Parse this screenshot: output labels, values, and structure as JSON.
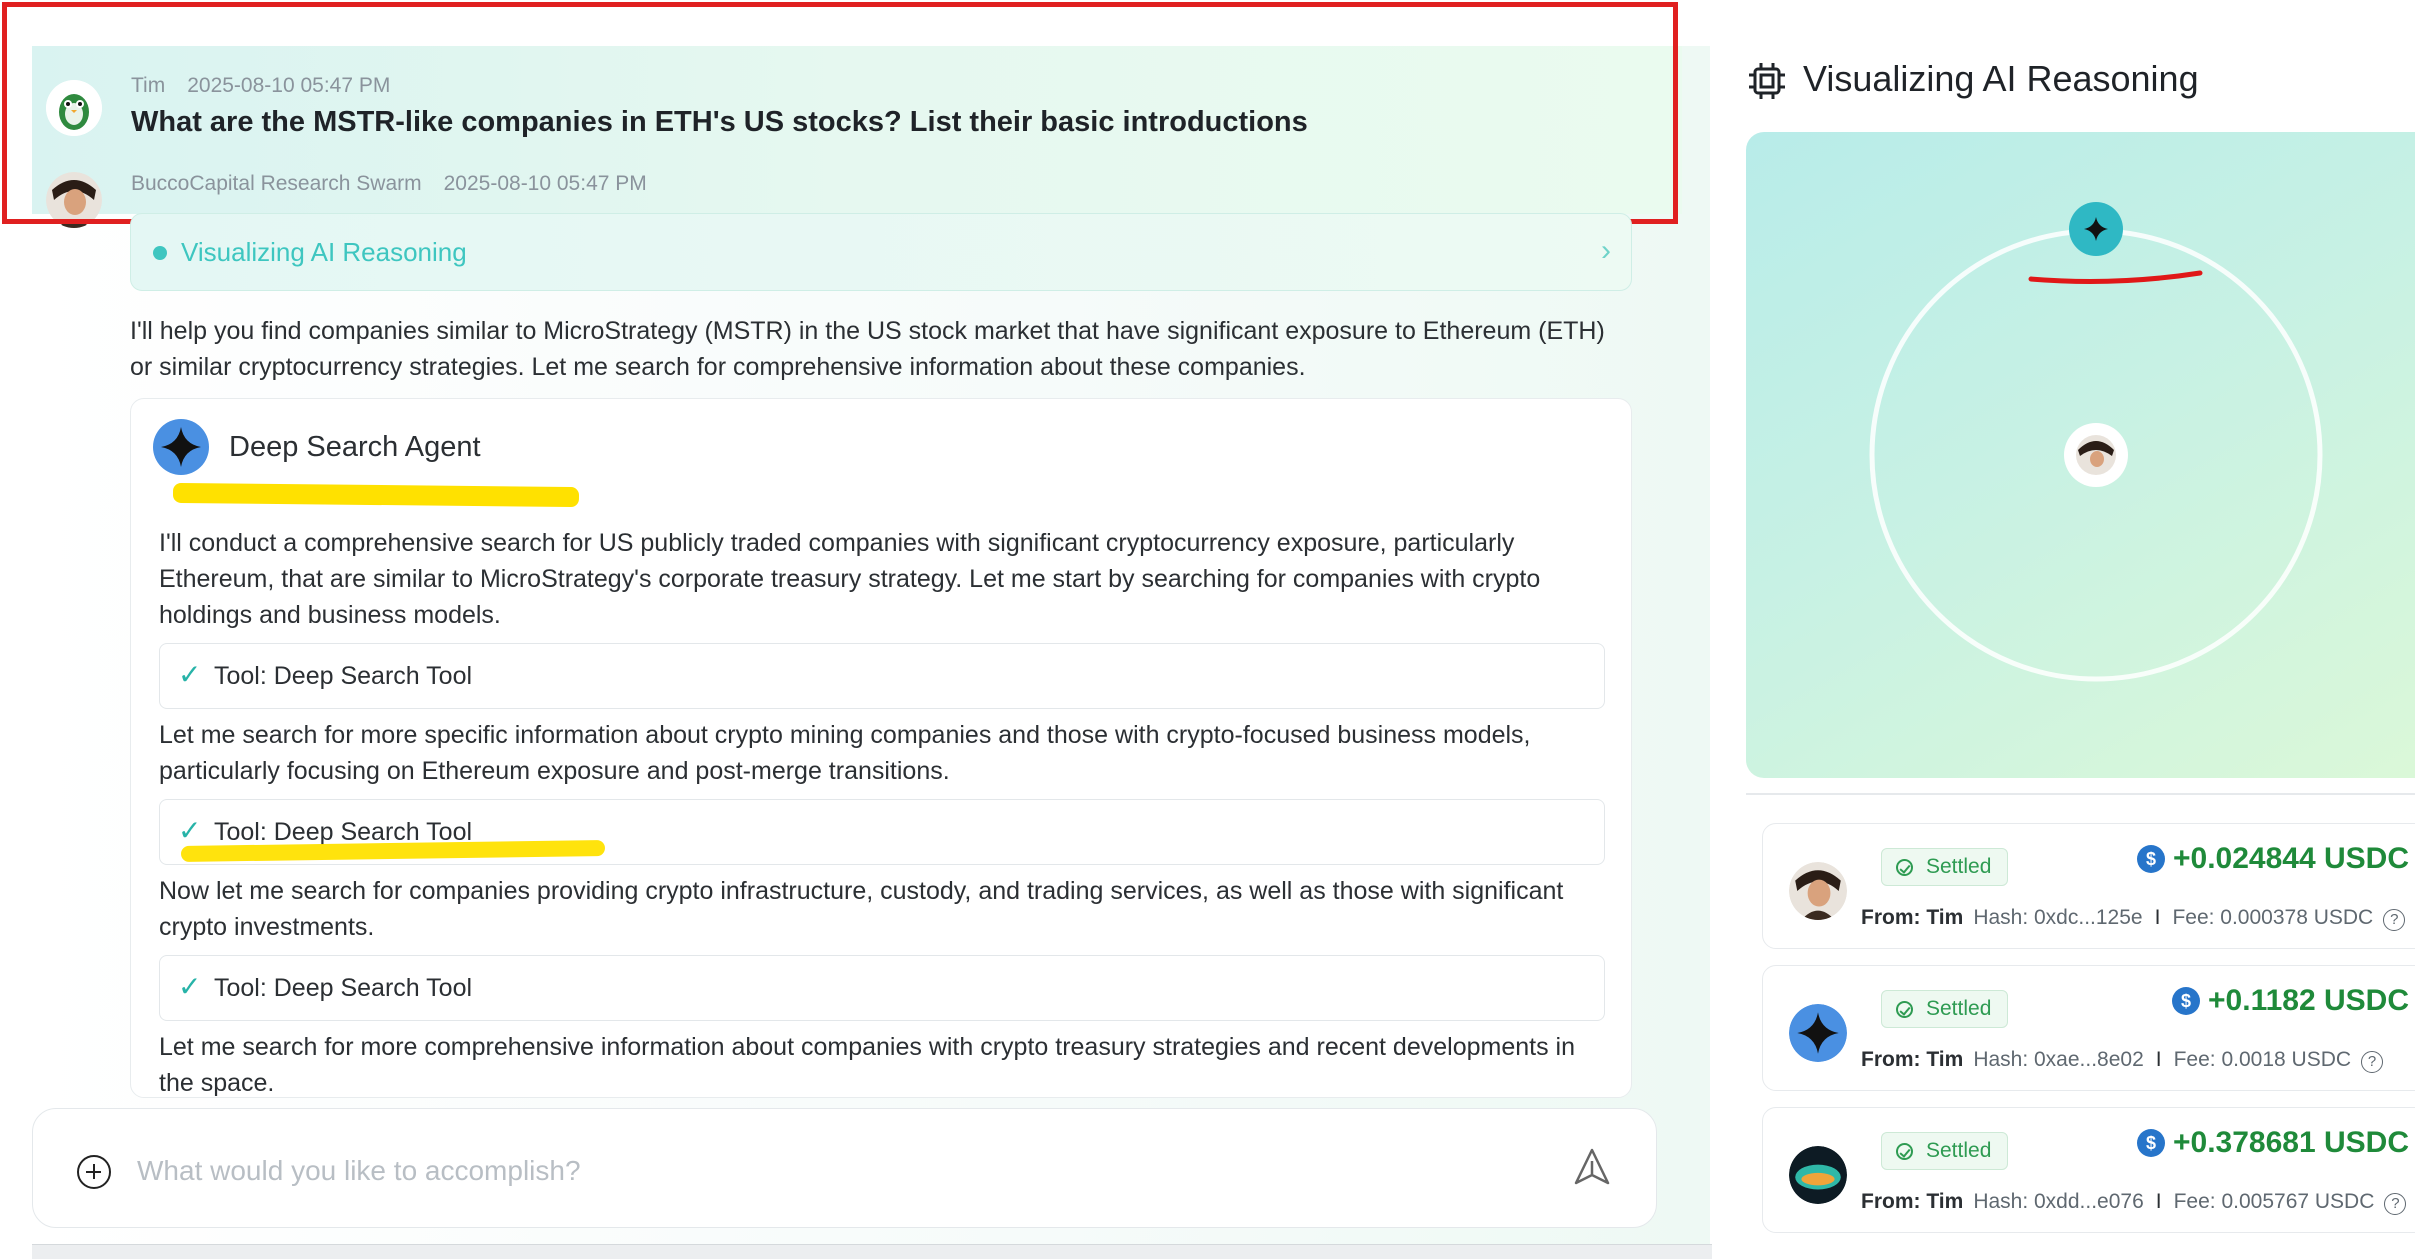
{
  "conversation": {
    "user_name": "Tim",
    "user_time": "2025-08-10 05:47 PM",
    "question": "What are the MSTR-like companies in ETH's US stocks? List their basic introductions",
    "agent_name": "BuccoCapital Research Swarm",
    "agent_time": "2025-08-10 05:47 PM",
    "reasoning_label": "Visualizing AI Reasoning",
    "intro": "I'll help you find companies similar to MicroStrategy (MSTR) in the US stock market that have significant exposure to Ethereum (ETH) or similar cryptocurrency strategies. Let me search for comprehensive information about these companies."
  },
  "agent_card": {
    "title": "Deep Search Agent",
    "para1": "I'll conduct a comprehensive search for US publicly traded companies with significant cryptocurrency exposure, particularly Ethereum, that are similar to MicroStrategy's corporate treasury strategy. Let me start by searching for companies with crypto holdings and business models.",
    "tool1": "Tool: Deep Search Tool",
    "para2": "Let me search for more specific information about crypto mining companies and those with crypto-focused business models, particularly focusing on Ethereum exposure and post-merge transitions.",
    "tool2": "Tool: Deep Search Tool",
    "para3": "Now let me search for companies providing crypto infrastructure, custody, and trading services, as well as those with significant crypto investments.",
    "tool3": "Tool: Deep Search Tool",
    "para4": "Let me search for more comprehensive information about companies with crypto treasury strategies and recent developments in the space."
  },
  "input": {
    "placeholder": "What would you like to accomplish?"
  },
  "right_panel": {
    "title": "Visualizing AI Reasoning",
    "transactions": [
      {
        "status": "Settled",
        "amount": "+0.024844 USDC",
        "from_label": "From:",
        "from": "Tim",
        "hash": "Hash: 0xdc...125e",
        "fee": "Fee: 0.000378 USDC"
      },
      {
        "status": "Settled",
        "amount": "+0.1182 USDC",
        "from_label": "From:",
        "from": "Tim",
        "hash": "Hash: 0xae...8e02",
        "fee": "Fee: 0.0018 USDC"
      },
      {
        "status": "Settled",
        "amount": "+0.378681 USDC",
        "from_label": "From:",
        "from": "Tim",
        "hash": "Hash: 0xdd...e076",
        "fee": "Fee: 0.005767 USDC"
      }
    ]
  },
  "colors": {
    "accent_teal": "#3ec6c0",
    "settled_green": "#2e9b52",
    "amount_green": "#1f8a3a",
    "usdc_blue": "#2775ca",
    "annotation_red": "#e02020",
    "annotation_yellow": "#ffe100"
  },
  "icons": [
    "tim-avatar-icon",
    "bucco-avatar-icon",
    "sparkle-icon",
    "check-icon",
    "plus-circle-icon",
    "send-icon",
    "chip-icon",
    "usdc-coin-icon",
    "question-circle-icon"
  ]
}
